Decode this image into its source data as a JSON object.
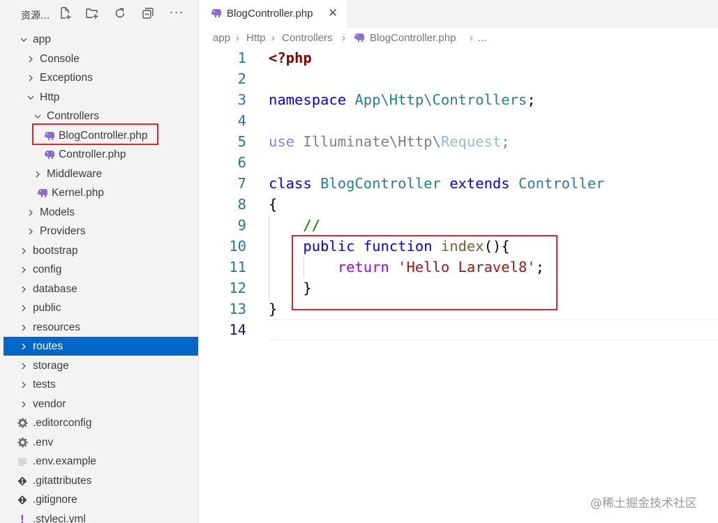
{
  "explorer": {
    "title": "资源...",
    "tools": [
      "new-file-icon",
      "new-folder-icon",
      "refresh-icon",
      "collapse-all-icon",
      "more-actions-icon"
    ],
    "tree": [
      {
        "label": "app",
        "depth": 0,
        "type": "folder",
        "expanded": true
      },
      {
        "label": "Console",
        "depth": 1,
        "type": "folder",
        "expanded": false
      },
      {
        "label": "Exceptions",
        "depth": 1,
        "type": "folder",
        "expanded": false
      },
      {
        "label": "Http",
        "depth": 1,
        "type": "folder",
        "expanded": true
      },
      {
        "label": "Controllers",
        "depth": 2,
        "type": "folder",
        "expanded": true
      },
      {
        "label": "BlogController.php",
        "depth": 3,
        "type": "php",
        "highlighted": true
      },
      {
        "label": "Controller.php",
        "depth": 3,
        "type": "php"
      },
      {
        "label": "Middleware",
        "depth": 2,
        "type": "folder",
        "expanded": false
      },
      {
        "label": "Kernel.php",
        "depth": 2,
        "type": "php"
      },
      {
        "label": "Models",
        "depth": 1,
        "type": "folder",
        "expanded": false
      },
      {
        "label": "Providers",
        "depth": 1,
        "type": "folder",
        "expanded": false
      },
      {
        "label": "bootstrap",
        "depth": 0,
        "type": "folder",
        "expanded": false
      },
      {
        "label": "config",
        "depth": 0,
        "type": "folder",
        "expanded": false
      },
      {
        "label": "database",
        "depth": 0,
        "type": "folder",
        "expanded": false
      },
      {
        "label": "public",
        "depth": 0,
        "type": "folder",
        "expanded": false
      },
      {
        "label": "resources",
        "depth": 0,
        "type": "folder",
        "expanded": false
      },
      {
        "label": "routes",
        "depth": 0,
        "type": "folder",
        "expanded": false,
        "selected": true
      },
      {
        "label": "storage",
        "depth": 0,
        "type": "folder",
        "expanded": false
      },
      {
        "label": "tests",
        "depth": 0,
        "type": "folder",
        "expanded": false
      },
      {
        "label": "vendor",
        "depth": 0,
        "type": "folder",
        "expanded": false
      },
      {
        "label": ".editorconfig",
        "depth": 0,
        "type": "gear"
      },
      {
        "label": ".env",
        "depth": 0,
        "type": "gear"
      },
      {
        "label": ".env.example",
        "depth": 0,
        "type": "text"
      },
      {
        "label": ".gitattributes",
        "depth": 0,
        "type": "git"
      },
      {
        "label": ".gitignore",
        "depth": 0,
        "type": "git"
      },
      {
        "label": ".styleci.yml",
        "depth": 0,
        "type": "yaml"
      }
    ]
  },
  "editor": {
    "tab": {
      "label": "BlogController.php",
      "close": "✕"
    },
    "breadcrumb": [
      "app",
      "Http",
      "Controllers",
      "BlogController.php",
      "..."
    ],
    "line_numbers": [
      "1",
      "2",
      "3",
      "4",
      "5",
      "6",
      "7",
      "8",
      "9",
      "10",
      "11",
      "12",
      "13",
      "14"
    ],
    "code": {
      "l1_php": "<?php",
      "l3_ns_kw": "namespace",
      "l3_ns": "App\\Http\\Controllers",
      "l3_semi": ";",
      "l5_use": "use",
      "l5_path": "Illuminate\\Http\\",
      "l5_cls": "Request",
      "l5_semi": ";",
      "l7_class": "class",
      "l7_name": "BlogController",
      "l7_extends": "extends",
      "l7_parent": "Controller",
      "l8_brace": "{",
      "l9_comment": "//",
      "l10_public": "public",
      "l10_function": "function",
      "l10_name": "index",
      "l10_rest": "(){",
      "l11_return": "return",
      "l11_str": "'Hello Laravel8'",
      "l11_semi": ";",
      "l12_brace": "}",
      "l13_brace": "}"
    }
  },
  "watermark": "@稀土掘金技术社区",
  "colors": {
    "accent_selected": "#0366c8",
    "highlight_box": "#e0252a",
    "php_icon": "#8a6fcf"
  }
}
